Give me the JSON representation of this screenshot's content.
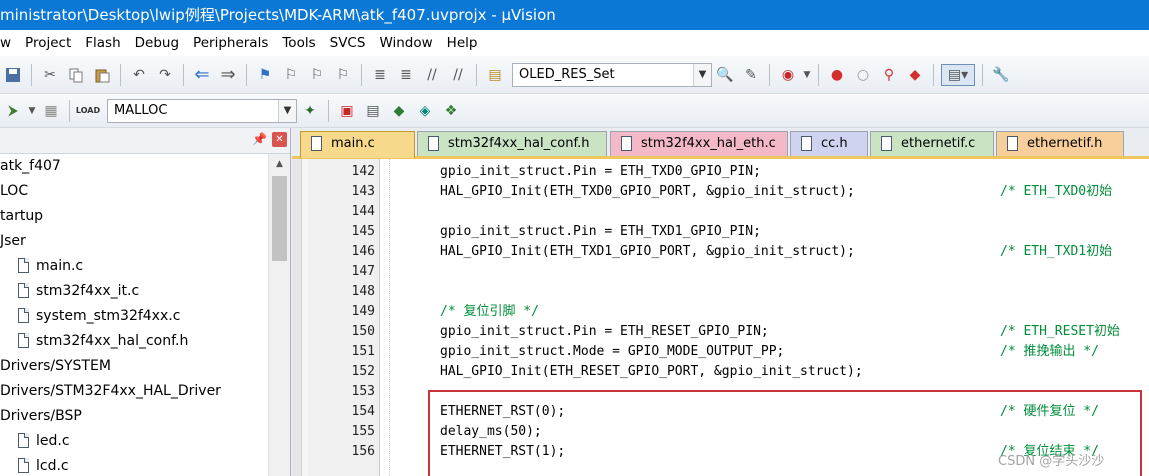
{
  "window": {
    "title": "ministrator\\Desktop\\lwip例程\\Projects\\MDK-ARM\\atk_f407.uvprojx - µVision"
  },
  "menu": [
    "w",
    "Project",
    "Flash",
    "Debug",
    "Peripherals",
    "Tools",
    "SVCS",
    "Window",
    "Help"
  ],
  "toolbar": {
    "target_combo": "OLED_RES_Set",
    "build_target": "MALLOC"
  },
  "project_panel": {
    "items": [
      {
        "label": "atk_f407",
        "file": false
      },
      {
        "label": "LOC",
        "file": false
      },
      {
        "label": "tartup",
        "file": false
      },
      {
        "label": "Jser",
        "file": false
      },
      {
        "label": "main.c",
        "file": true
      },
      {
        "label": "stm32f4xx_it.c",
        "file": true
      },
      {
        "label": "system_stm32f4xx.c",
        "file": true
      },
      {
        "label": "stm32f4xx_hal_conf.h",
        "file": true
      },
      {
        "label": "Drivers/SYSTEM",
        "file": false
      },
      {
        "label": "Drivers/STM32F4xx_HAL_Driver",
        "file": false
      },
      {
        "label": "Drivers/BSP",
        "file": false
      },
      {
        "label": "led.c",
        "file": true
      },
      {
        "label": "lcd.c",
        "file": true
      }
    ]
  },
  "tabs": [
    {
      "label": "main.c",
      "color": "#f6d98a",
      "active": true
    },
    {
      "label": "stm32f4xx_hal_conf.h",
      "color": "#c9e3c3"
    },
    {
      "label": "stm32f4xx_hal_eth.c",
      "color": "#f4b9c7"
    },
    {
      "label": "cc.h",
      "color": "#cfd3f0"
    },
    {
      "label": "ethernetif.c",
      "color": "#c9e3c3"
    },
    {
      "label": "ethernetif.h",
      "color": "#f8cf9a"
    }
  ],
  "editor": {
    "lines": [
      {
        "n": "142",
        "code": "gpio_init_struct.Pin = ETH_TXD0_GPIO_PIN;",
        "comment": ""
      },
      {
        "n": "143",
        "code": "HAL_GPIO_Init(ETH_TXD0_GPIO_PORT, &gpio_init_struct);",
        "comment": "/* ETH_TXD0初始"
      },
      {
        "n": "144",
        "code": "",
        "comment": ""
      },
      {
        "n": "145",
        "code": "gpio_init_struct.Pin = ETH_TXD1_GPIO_PIN;",
        "comment": ""
      },
      {
        "n": "146",
        "code": "HAL_GPIO_Init(ETH_TXD1_GPIO_PORT, &gpio_init_struct);",
        "comment": "/* ETH_TXD1初始"
      },
      {
        "n": "147",
        "code": "",
        "comment": ""
      },
      {
        "n": "148",
        "code": "",
        "comment": ""
      },
      {
        "n": "149",
        "code": "",
        "comment": "/* 复位引脚 */"
      },
      {
        "n": "150",
        "code": "gpio_init_struct.Pin = ETH_RESET_GPIO_PIN;",
        "comment": "/* ETH_RESET初始"
      },
      {
        "n": "151",
        "code": "gpio_init_struct.Mode = GPIO_MODE_OUTPUT_PP;",
        "comment": "/* 推挽输出 */"
      },
      {
        "n": "152",
        "code": "HAL_GPIO_Init(ETH_RESET_GPIO_PORT, &gpio_init_struct);",
        "comment": ""
      },
      {
        "n": "153",
        "code": "",
        "comment": ""
      },
      {
        "n": "154",
        "code": "ETHERNET_RST(0);",
        "comment": "/* 硬件复位 */"
      },
      {
        "n": "155",
        "code": "delay_ms(50);",
        "comment": ""
      },
      {
        "n": "156",
        "code": "ETHERNET_RST(1);",
        "comment": "/* 复位结束 */"
      }
    ]
  },
  "watermark": "CSDN @学头沙沙"
}
